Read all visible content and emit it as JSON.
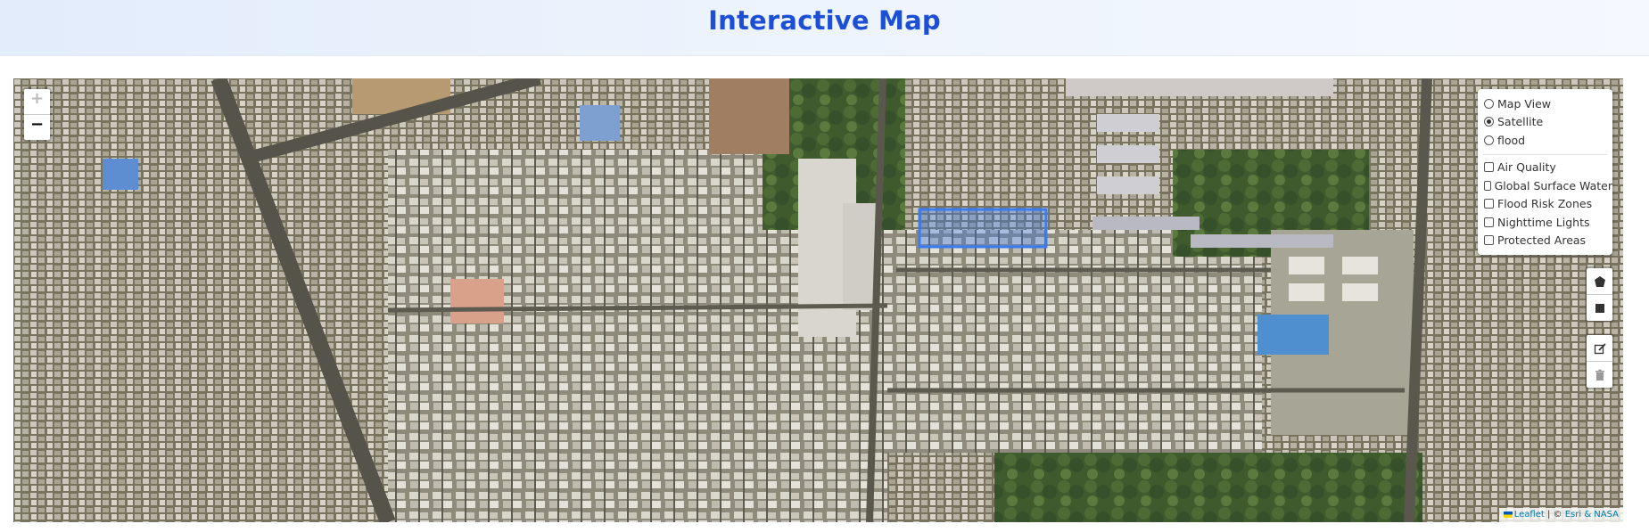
{
  "header": {
    "title": "Interactive Map"
  },
  "map": {
    "zoom_in_label": "+",
    "zoom_out_label": "−",
    "selection_color": "#3a7bf0",
    "base_layers": [
      {
        "label": "Map View",
        "selected": false
      },
      {
        "label": "Satellite",
        "selected": true
      },
      {
        "label": "flood",
        "selected": false
      }
    ],
    "overlays": [
      {
        "label": "Air Quality",
        "checked": false
      },
      {
        "label": "Global Surface Water",
        "checked": false
      },
      {
        "label": "Flood Risk Zones",
        "checked": false
      },
      {
        "label": "Nighttime Lights",
        "checked": false
      },
      {
        "label": "Protected Areas",
        "checked": false
      }
    ],
    "draw_tools": [
      "polygon-icon",
      "rectangle-icon"
    ],
    "edit_tools": [
      "edit-icon",
      "trash-icon"
    ],
    "attribution": {
      "leaflet": "Leaflet",
      "separator": " | © ",
      "provider": "Esri & NASA"
    }
  }
}
